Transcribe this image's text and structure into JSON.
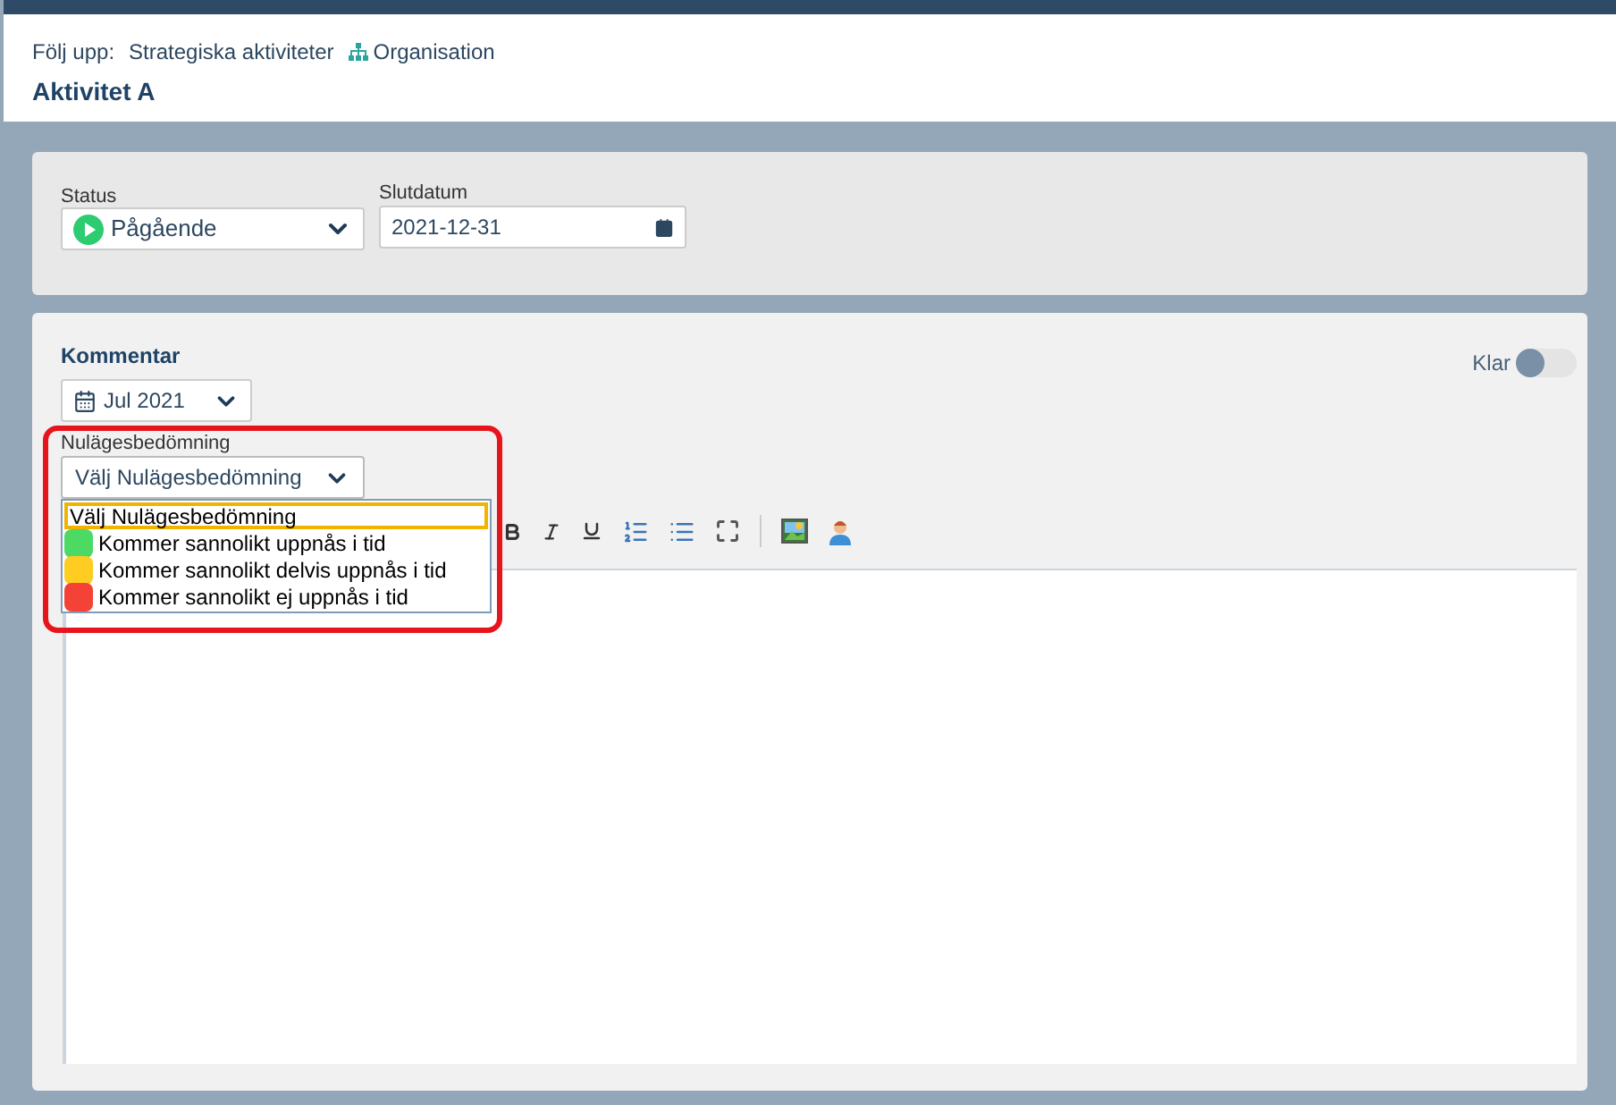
{
  "breadcrumb": {
    "label": "Följ upp:",
    "items": [
      {
        "text": "Strategiska aktiviteter",
        "icon": false
      },
      {
        "text": "Organisation",
        "icon": true
      }
    ]
  },
  "title": "Aktivitet A",
  "status": {
    "label": "Status",
    "value": "Pågående"
  },
  "end_date": {
    "label": "Slutdatum",
    "value": "2021-12-31"
  },
  "comment": {
    "heading": "Kommentar",
    "period": "Jul 2021",
    "done_label": "Klar",
    "done": false
  },
  "assessment": {
    "label": "Nulägesbedömning",
    "value": "Välj Nulägesbedömning",
    "expanded": true,
    "options": [
      {
        "text": "Välj Nulägesbedömning",
        "selected": true
      },
      {
        "text": "Kommer sannolikt uppnås i tid",
        "color": "#4cd964",
        "selected": false
      },
      {
        "text": "Kommer sannolikt delvis uppnås i tid",
        "color": "#ffcc22",
        "selected": false
      },
      {
        "text": "Kommer sannolikt ej uppnås i tid",
        "color": "#f44336",
        "selected": false
      }
    ]
  }
}
